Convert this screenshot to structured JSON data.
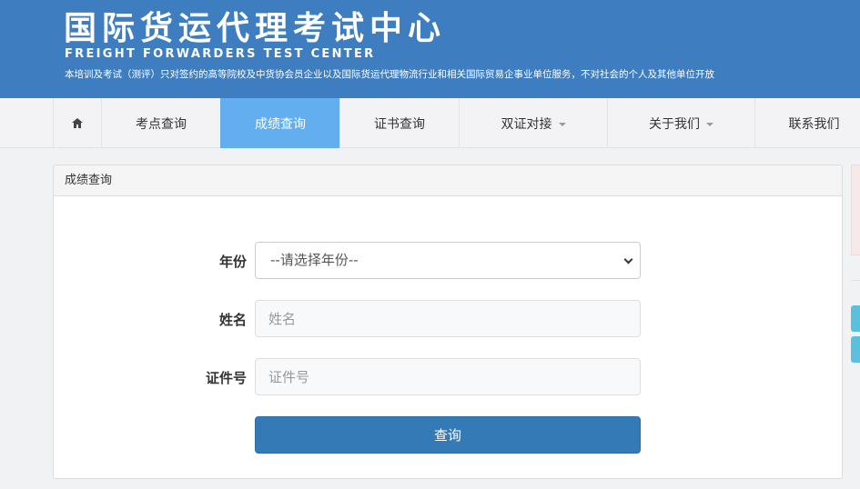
{
  "header": {
    "title": "国际货运代理考试中心",
    "subtitle": "FREIGHT FORWARDERS TEST CENTER",
    "description": "本培训及考试（测评）只对签约的高等院校及中货协会员企业以及国际货运代理物流行业和相关国际贸易企事业单位服务，不对社会的个人及其他单位开放"
  },
  "nav": {
    "home_icon": "home-icon",
    "items": [
      {
        "label": "考点查询"
      },
      {
        "label": "成绩查询",
        "active": true
      },
      {
        "label": "证书查询"
      },
      {
        "label": "双证对接",
        "dropdown": true
      },
      {
        "label": "关于我们",
        "dropdown": true
      },
      {
        "label": "联系我们"
      }
    ],
    "active_color": "#62aeee"
  },
  "panel": {
    "heading": "成绩查询",
    "form": {
      "year_label": "年份",
      "year_selected": "--请选择年份--",
      "name_label": "姓名",
      "name_placeholder": "姓名",
      "cert_label": "证件号",
      "cert_placeholder": "证件号",
      "submit_label": "查询"
    }
  },
  "colors": {
    "header_bg": "#3e7ec0",
    "button_bg": "#337ab7",
    "side_button": "#5bc0de"
  }
}
